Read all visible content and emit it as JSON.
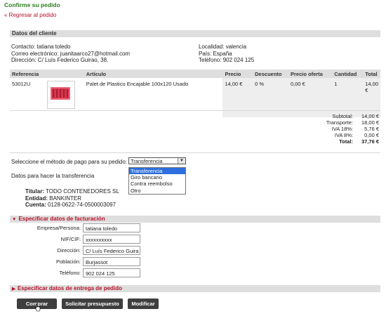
{
  "page": {
    "title": "Confirme su pedido",
    "back_link": "« Regresar al pedido"
  },
  "customer": {
    "section_title": "Datos del cliente",
    "contact": "Contacto: tatiana toledo",
    "email": "Correo electrónico: juanitaarco27@hotmail.com",
    "address": "Dirección: C/ Luís Federico Guirao, 38.",
    "locality": "Localidad: valencia",
    "country": "País: España",
    "phone": "Teléfono: 902 024 125"
  },
  "items_table": {
    "headers": [
      "Referencia",
      "Artículo",
      "Precio",
      "Descuento",
      "Precio oferta",
      "Cantidad",
      "Total"
    ],
    "rows": [
      {
        "reference": "53012U",
        "article": "Palet de Plastico Encajable 100x120 Usado",
        "price": "14,00 €",
        "discount": "0 %",
        "offer_price": "0,00 €",
        "quantity": "1",
        "total": "14,00 €"
      }
    ]
  },
  "totals": {
    "subtotal_label": "Subtotal:",
    "subtotal": "14,00 €",
    "shipping_label": "Transporte:",
    "shipping": "18,00 €",
    "iva18_label": "IVA 18%:",
    "iva18": "5,76 €",
    "iva8_label": "IVA 8%:",
    "iva8": "0,00 €",
    "total_label": "Total:",
    "total": "37,76 €"
  },
  "payment": {
    "label": "Seleccione el método de pago para su pedido:",
    "selected": "Transferencia",
    "options": [
      "Transferencia",
      "Giro bancario",
      "Contra reembolso",
      "Otro"
    ],
    "transfer_label": "Datos para hacer la transferencia",
    "holder_label": "Titular:",
    "holder": "TODO CONTENEDORES SL",
    "bank_label": "Entidad:",
    "bank": "BANKINTER",
    "account_label": "Cuenta:",
    "account": "0128-0622-74-0500003097"
  },
  "billing": {
    "title": "Especificar datos de facturación",
    "company_label": "Empresa/Persona:",
    "company": "tatiana toledo",
    "nif_label": "NIF/CIF:",
    "nif": "xxxxxxxxxx",
    "address_label": "Dirección:",
    "address": "C/ Luís Federico Guira",
    "city_label": "Población:",
    "city": "Burjassot",
    "phone_label": "Teléfono:",
    "phone": "902 024 125"
  },
  "delivery": {
    "title": "Especificar datos de entrega de pedido"
  },
  "buttons": {
    "buy": "Comprar",
    "quote": "Solicitar presupuesto",
    "modify": "Modificar"
  },
  "colors": {
    "title_green": "#2e7d1f",
    "link_red": "#b8122a",
    "button_bg": "#3e3e3e",
    "header_gray": "#dedede",
    "select_blue": "#2d6fdd"
  }
}
